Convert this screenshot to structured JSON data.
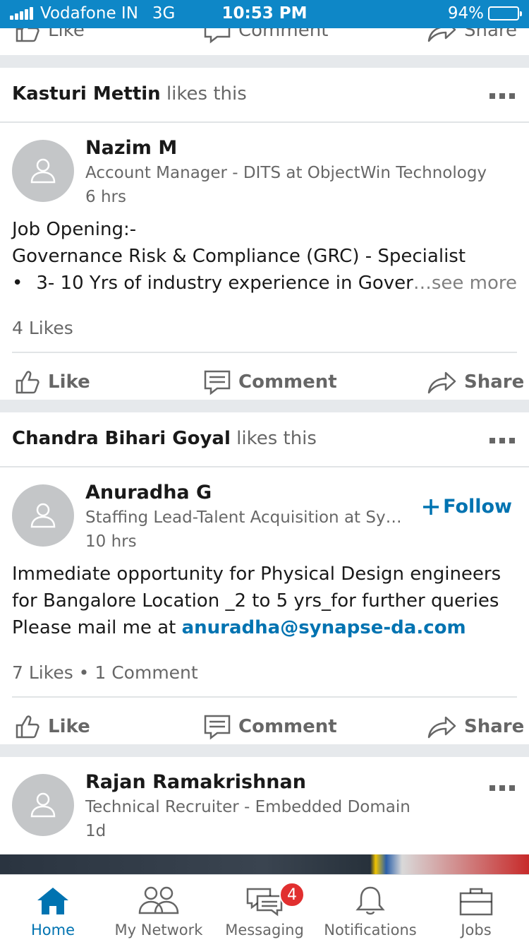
{
  "status_bar": {
    "carrier": "Vodafone IN",
    "network": "3G",
    "time": "10:53 PM",
    "battery": "94%",
    "battery_level": 0.94
  },
  "top_partial": {
    "like": "Like",
    "comment": "Comment",
    "share": "Share"
  },
  "posts": [
    {
      "liker": "Kasturi Mettin",
      "liker_suffix": "likes this",
      "author": "Nazim M",
      "title": "Account Manager - DITS at ObjectWin Technology",
      "time": "6 hrs",
      "text_line1": "Job Opening:-",
      "text_line2": "Governance Risk & Compliance (GRC) - Specialist",
      "text_bullet": "•",
      "text_line3": "3- 10 Yrs of industry experience in Gover",
      "see_more": "…see more",
      "social": "4 Likes",
      "like": "Like",
      "comment": "Comment",
      "share": "Share"
    },
    {
      "liker": "Chandra Bihari Goyal",
      "liker_suffix": "likes this",
      "author": "Anuradha G",
      "title": "Staffing Lead-Talent Acquisition at Syna…",
      "time": "10 hrs",
      "follow": "Follow",
      "text": "Immediate opportunity for Physical Design engineers for Bangalore Location _2 to 5 yrs_for further queries Please mail me at ",
      "email": "anuradha@synapse-da.com",
      "social": "7 Likes • 1 Comment",
      "like": "Like",
      "comment": "Comment",
      "share": "Share"
    },
    {
      "author": "Rajan Ramakrishnan",
      "title": "Technical Recruiter - Embedded Domain",
      "time": "1d"
    }
  ],
  "nav": {
    "home": "Home",
    "network": "My Network",
    "messaging": "Messaging",
    "messaging_badge": "4",
    "notifications": "Notifications",
    "jobs": "Jobs"
  },
  "colors": {
    "status_bar": "#0e87c7",
    "accent": "#0073b1",
    "badge": "#e12f2f"
  }
}
